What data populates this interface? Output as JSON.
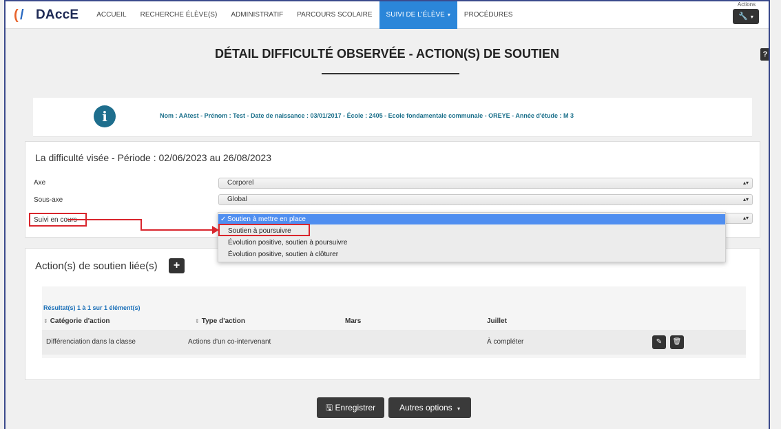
{
  "app": {
    "logo_text": "DAccE",
    "colors": {
      "nav_active": "#2b86d9",
      "info_text": "#1a6f8a",
      "highlight": "#d9252c",
      "dropdown_selected": "#4f8ef0"
    }
  },
  "nav": {
    "items": [
      "ACCUEIL",
      "RECHERCHE ÉLÈVE(S)",
      "ADMINISTRATIF",
      "PARCOURS SCOLAIRE",
      "SUIVI DE L'ÉLÈVE",
      "PROCÉDURES"
    ],
    "active_index": 4,
    "actions_label": "Actions",
    "actions_icon": "wrench-icon"
  },
  "page": {
    "title": "DÉTAIL DIFFICULTÉ OBSERVÉE - ACTION(S) DE SOUTIEN",
    "help": "?"
  },
  "student_info": {
    "icon": "info-icon",
    "text": "Nom : AAtest - Prénom : Test - Date de naissance : 03/01/2017 - École : 2405 - Ecole fondamentale communale - OREYE - Année d'étude : M 3"
  },
  "difficulty": {
    "heading": "La difficulté visée - Période : 02/06/2023 au 26/08/2023",
    "fields": [
      {
        "label": "Axe",
        "value": "Corporel"
      },
      {
        "label": "Sous-axe",
        "value": "Global"
      },
      {
        "label": "Suivi en cours",
        "value": ""
      }
    ],
    "dropdown_options": [
      "Soutien à mettre en place",
      "Soutien à poursuivre",
      "Évolution positive, soutien à poursuivre",
      "Évolution positive, soutien à clôturer"
    ],
    "dropdown_selected_index": 0,
    "dropdown_highlighted_index": 1
  },
  "actions": {
    "heading": "Action(s) de soutien liée(s)",
    "add_label": "+",
    "result_count": "Résultat(s) 1 à 1 sur 1 élément(s)",
    "columns": [
      "Catégorie d'action",
      "Type d'action",
      "Mars",
      "Juillet"
    ],
    "rows": [
      {
        "category": "Différenciation dans la classe",
        "type": "Actions d'un co-intervenant",
        "mars": "",
        "juillet": "À compléter"
      }
    ]
  },
  "footer": {
    "save_label": "Enregistrer",
    "other_label": "Autres options"
  }
}
